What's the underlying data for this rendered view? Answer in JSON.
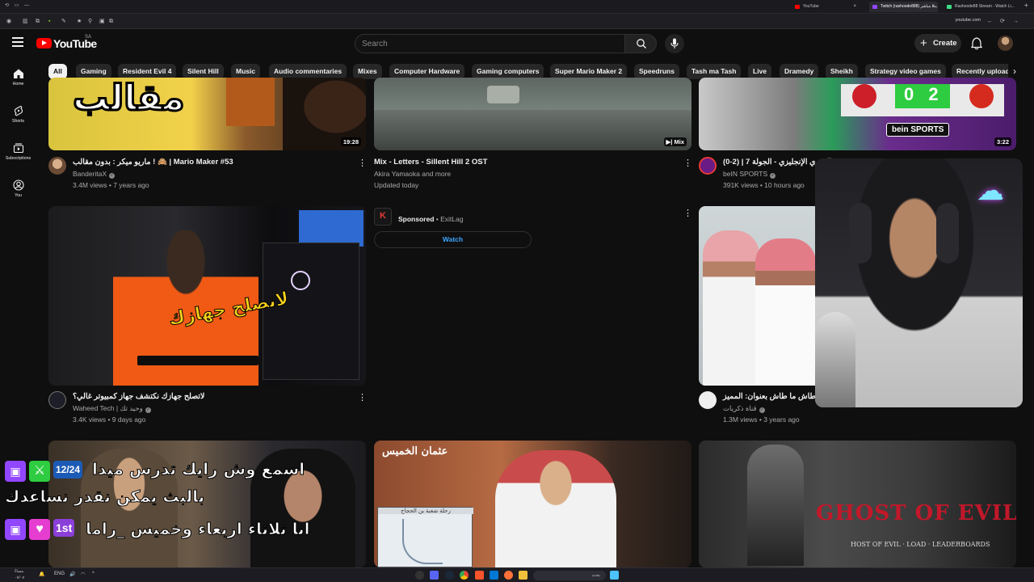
{
  "browser": {
    "tabs": [
      {
        "title": "YouTube",
        "active": true
      },
      {
        "title": "Twitch (rashoode888) بث مباشر",
        "active": false
      },
      {
        "title": "Rashoode88 Stream - Watch Li...",
        "active": false
      }
    ],
    "url": "youtube.com"
  },
  "header": {
    "logo": "YouTube",
    "country_code": "SA",
    "search_placeholder": "Search",
    "create_label": "Create"
  },
  "chips": [
    "All",
    "Gaming",
    "Resident Evil 4",
    "Silent Hill",
    "Music",
    "Audio commentaries",
    "Mixes",
    "Computer Hardware",
    "Gaming computers",
    "Super Mario Maker 2",
    "Speedruns",
    "Tash ma Tash",
    "Live",
    "Dramedy",
    "Sheikh",
    "Strategy video games",
    "Recently upload"
  ],
  "guide": [
    {
      "label": "Home",
      "icon": "home-icon"
    },
    {
      "label": "Shorts",
      "icon": "shorts-icon"
    },
    {
      "label": "Subscriptions",
      "icon": "subscriptions-icon"
    },
    {
      "label": "You",
      "icon": "you-icon"
    }
  ],
  "videos": [
    {
      "title": "ماريو ميكر : بدون مقالب ! 🙈 | Mario Maker #53",
      "channel": "BanderitaX",
      "meta": "3.4M views • 7 years ago",
      "duration": "19:28",
      "thumb_text": "مقالب"
    },
    {
      "title": "Mix - Letters - Sillent Hill 2 OST",
      "channel": "Akira Yamaoka and more",
      "meta": "Updated today",
      "badge": "Mix"
    },
    {
      "title": "الدوري الإنجليزي - الجولة 7 | (2-0)",
      "channel": "beIN SPORTS",
      "meta": "391K views • 10 hours ago",
      "duration": "3:22",
      "thumb_text": "bein SPORTS",
      "score": "0 2"
    },
    {
      "title": "لاتصلح جهازك نكتشف جهاز كمبيوتر غالي؟",
      "channel": "Waheed Tech | وحيد تك",
      "meta": "3.4K views • 9 days ago",
      "thumb_text": "لاتصلح جهازك"
    },
    {
      "title": "طاش ما طاش بعنوان: المميز",
      "channel": "قناة ذكريات",
      "meta": "1.3M views • 3 years ago"
    },
    {
      "thumb_text": "GHOST OF EVIL",
      "thumb_sub": "HOST OF EVIL · LOAD · LEADERBOARDS"
    },
    {
      "thumb_text": "رحلة شعبة بن الحجاج",
      "thumb_sub": "عثمان الخميس"
    }
  ],
  "sponsored": {
    "label": "Sponsored",
    "advertiser": "ExitLag",
    "cta": "Watch"
  },
  "overlay": {
    "chat_line_1": "اسمع وش رايك تدرس ميدا",
    "chat_line_2": "بالبث يمكن نقدر نساعدك",
    "chat_line_3": "انا ثلاثاء اربعاء وخميس _راما",
    "badge_1": "12/24",
    "badge_2": "1st"
  },
  "taskbar": {
    "search": "بحث",
    "lang": "ENG",
    "time": "مساءً",
    "date": "٠٧/٠٧"
  },
  "colors": {
    "background": "#0f0f0f",
    "chip": "#272727",
    "accent": "#ff0000",
    "link": "#3ea6ff"
  }
}
